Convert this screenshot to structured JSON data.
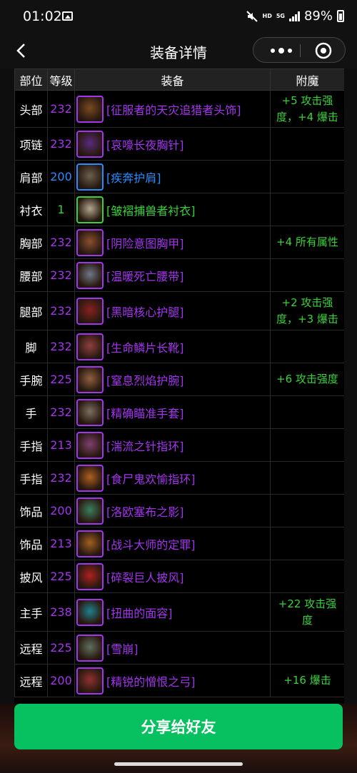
{
  "status": {
    "time": "01:02",
    "net_top": "5G",
    "net_hd": "HD",
    "battery": "89%"
  },
  "nav": {
    "title": "装备详情"
  },
  "colors": {
    "epic": "#a335ee",
    "rare": "#2a8cff",
    "uncommon": "#3ad23a",
    "share": "#07c160"
  },
  "table": {
    "headers": [
      "部位",
      "等级",
      "装备",
      "附魔"
    ],
    "rows": [
      {
        "slot": "头部",
        "ilvl": "232",
        "name": "[征服者的天灾追猎者头饰]",
        "quality": "epic",
        "ench1": "+5 攻击强",
        "ench2": "度，+4 爆击",
        "icon": "helm-icon",
        "hue": "#7a4a20"
      },
      {
        "slot": "项链",
        "ilvl": "232",
        "name": "[哀嚎长夜胸针]",
        "quality": "epic",
        "ench1": "",
        "ench2": "",
        "icon": "necklace-icon",
        "hue": "#5a2a80"
      },
      {
        "slot": "肩部",
        "ilvl": "200",
        "name": "[疾奔护肩]",
        "quality": "rare",
        "ench1": "",
        "ench2": "",
        "icon": "shoulder-icon",
        "hue": "#6a6050"
      },
      {
        "slot": "衬衣",
        "ilvl": "1",
        "name": "[皱褶捕兽者衬衣]",
        "quality": "green",
        "ench1": "",
        "ench2": "",
        "icon": "shirt-icon",
        "hue": "#b0a890"
      },
      {
        "slot": "胸部",
        "ilvl": "232",
        "name": "[阴险意图胸甲]",
        "quality": "epic",
        "ench1": "+4 所有属性",
        "ench2": "",
        "icon": "chest-icon",
        "hue": "#8a5030"
      },
      {
        "slot": "腰部",
        "ilvl": "232",
        "name": "[温暖死亡腰带]",
        "quality": "epic",
        "ench1": "",
        "ench2": "",
        "icon": "belt-icon",
        "hue": "#707888"
      },
      {
        "slot": "腿部",
        "ilvl": "232",
        "name": "[黑暗核心护腿]",
        "quality": "epic",
        "ench1": "+2 攻击强",
        "ench2": "度，+3 爆击",
        "icon": "legs-icon",
        "hue": "#8a2020"
      },
      {
        "slot": "脚",
        "ilvl": "232",
        "name": "[生命鳞片长靴]",
        "quality": "epic",
        "ench1": "",
        "ench2": "",
        "icon": "boots-icon",
        "hue": "#904040"
      },
      {
        "slot": "手腕",
        "ilvl": "225",
        "name": "[窒息烈焰护腕]",
        "quality": "epic",
        "ench1": "+6 攻击强度",
        "ench2": "",
        "icon": "bracer-icon",
        "hue": "#906040"
      },
      {
        "slot": "手",
        "ilvl": "232",
        "name": "[精确瞄准手套]",
        "quality": "epic",
        "ench1": "",
        "ench2": "",
        "icon": "gloves-icon",
        "hue": "#7a7060"
      },
      {
        "slot": "手指",
        "ilvl": "213",
        "name": "[湍流之针指环]",
        "quality": "epic",
        "ench1": "",
        "ench2": "",
        "icon": "ring-icon",
        "hue": "#804070"
      },
      {
        "slot": "手指",
        "ilvl": "232",
        "name": "[食尸鬼欢愉指环]",
        "quality": "epic",
        "ench1": "",
        "ench2": "",
        "icon": "ring-icon",
        "hue": "#b06020"
      },
      {
        "slot": "饰品",
        "ilvl": "200",
        "name": "[洛欧塞布之影]",
        "quality": "epic",
        "ench1": "",
        "ench2": "",
        "icon": "trinket-icon",
        "hue": "#3a8060"
      },
      {
        "slot": "饰品",
        "ilvl": "213",
        "name": "[战斗大师的定罪]",
        "quality": "epic",
        "ench1": "",
        "ench2": "",
        "icon": "trinket-icon",
        "hue": "#a06020"
      },
      {
        "slot": "披风",
        "ilvl": "225",
        "name": "[碎裂巨人披风]",
        "quality": "epic",
        "ench1": "",
        "ench2": "",
        "icon": "cloak-icon",
        "hue": "#b02020"
      },
      {
        "slot": "主手",
        "ilvl": "238",
        "name": "[扭曲的面容]",
        "quality": "epic",
        "ench1": "+22 攻击强",
        "ench2": "度",
        "icon": "weapon-icon",
        "hue": "#208090"
      },
      {
        "slot": "远程",
        "ilvl": "225",
        "name": "[雪崩]",
        "quality": "epic",
        "ench1": "",
        "ench2": "",
        "icon": "gun-icon",
        "hue": "#607060"
      },
      {
        "slot": "远程",
        "ilvl": "200",
        "name": "[精锐的憎恨之弓]",
        "quality": "epic",
        "ench1": "+16 爆击",
        "ench2": "",
        "icon": "bow-icon",
        "hue": "#903030"
      }
    ]
  },
  "share": {
    "label": "分享给好友"
  }
}
